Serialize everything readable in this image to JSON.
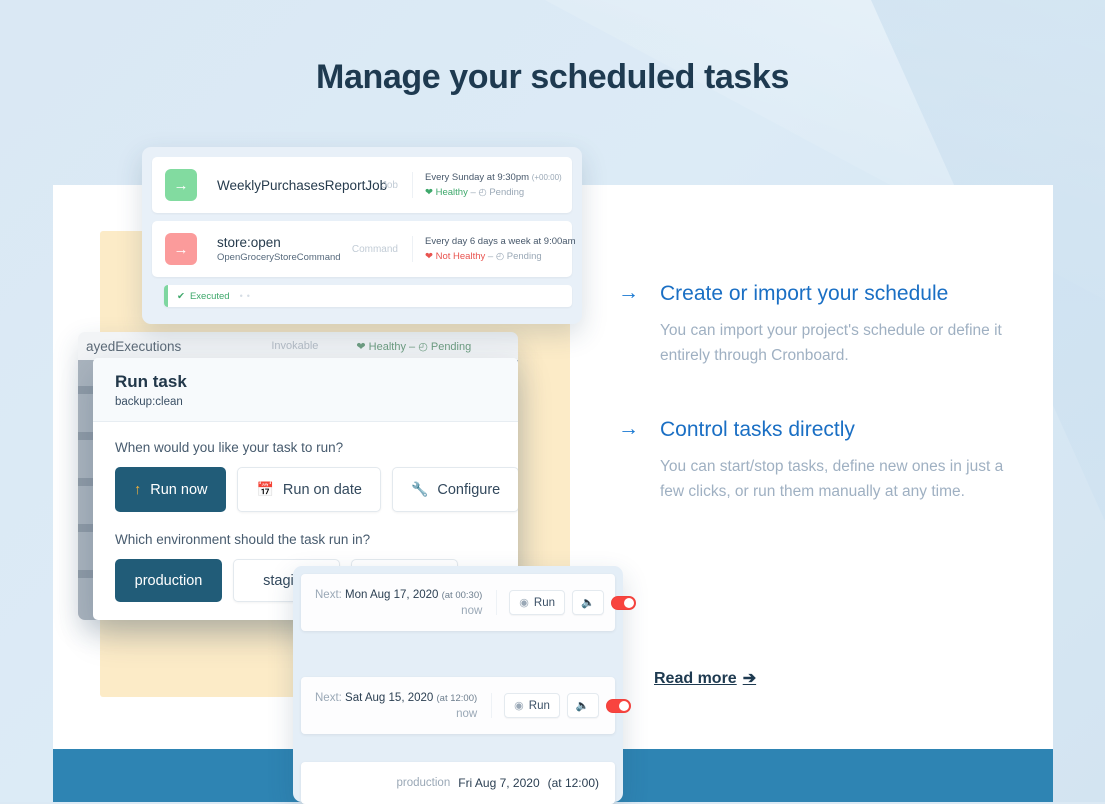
{
  "headline": "Manage your scheduled tasks",
  "colors": {
    "background": "#dbe9f4",
    "accent_blue": "#1a6fc4",
    "band_blue": "#2e84b3",
    "dark_navy": "#1e3a50",
    "yellow_card": "#fcebc7",
    "button_primary": "#215c78",
    "healthy_green": "#3ea86b",
    "unhealthy_red": "#e8534f",
    "toggle_red": "#f8443f"
  },
  "features": [
    {
      "arrow": "→",
      "title": "Create or import your schedule",
      "body": "You can import your project's schedule or define it entirely through Cronboard."
    },
    {
      "arrow": "→",
      "title": "Control tasks directly",
      "body": "You can start/stop tasks, define new ones in just a few clicks, or run them manually at any time."
    }
  ],
  "read_more": {
    "label": "Read more",
    "arrow": "➔"
  },
  "jobs_card": {
    "rows": [
      {
        "icon": "arrow-right-icon",
        "icon_color": "green",
        "name": "WeeklyPurchasesReportJob",
        "subtitle": "",
        "tag": "Job",
        "schedule": "Every Sunday at 9:30pm",
        "timezone": "(+00:00)",
        "health_icon": "❤",
        "health": "Healthy",
        "separator": "–",
        "status_icon": "◴",
        "status": "Pending",
        "health_state": "ok"
      },
      {
        "icon": "arrow-right-icon",
        "icon_color": "red",
        "name": "store:open",
        "subtitle": "OpenGroceryStoreCommand",
        "tag": "Command",
        "schedule": "Every day 6 days a week at 9:00am",
        "timezone": "",
        "health_icon": "❤",
        "health": "Not Healthy",
        "separator": "–",
        "status_icon": "◴",
        "status": "Pending",
        "health_state": "bad"
      }
    ],
    "execution": {
      "icon": "✔",
      "label": "Executed",
      "dots": "••"
    }
  },
  "dashboard": {
    "row_name": "ayedExecutions",
    "tag": "Invokable",
    "health": "❤ Healthy – ◴ Pending"
  },
  "run_modal": {
    "title": "Run task",
    "subtitle": "backup:clean",
    "question_when": "When would you like your task to run?",
    "when_options": [
      {
        "icon": "↑",
        "icon_name": "arrow-up-icon",
        "label": "Run now",
        "selected": true
      },
      {
        "icon": "▦",
        "icon_name": "calendar-icon",
        "label": "Run on date",
        "selected": false
      },
      {
        "icon": "🔧",
        "icon_name": "wrench-icon",
        "label": "Configure",
        "selected": false
      }
    ],
    "question_env": "Which environment should the task run in?",
    "env_options": [
      {
        "label": "production",
        "selected": true
      },
      {
        "label": "staging",
        "selected": false
      },
      {
        "label": "",
        "selected": false
      }
    ]
  },
  "next_card": {
    "rows": [
      {
        "label": "Next:",
        "date": "Mon Aug 17, 2020",
        "time": "(at 00:30)",
        "relative": "now",
        "run_label": "Run",
        "run_icon": "▶",
        "mute_icon": "🔈",
        "toggle_on": true
      },
      {
        "label": "Next:",
        "date": "Sat Aug 15, 2020",
        "time": "(at 12:00)",
        "relative": "now",
        "run_label": "Run",
        "run_icon": "▶",
        "mute_icon": "🔈",
        "toggle_on": true
      }
    ],
    "history": {
      "env": "production",
      "date": "Fri Aug 7, 2020",
      "time": "(at 12:00)"
    }
  }
}
